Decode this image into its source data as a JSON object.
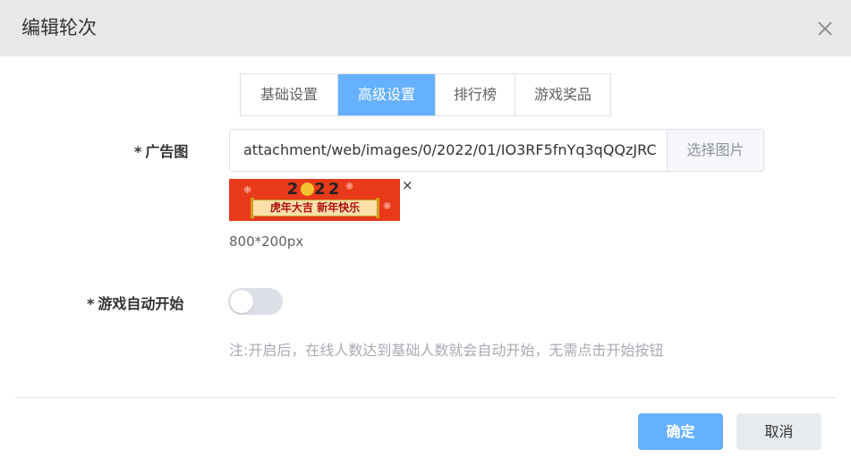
{
  "dialog": {
    "title": "编辑轮次"
  },
  "tabs": [
    {
      "label": "基础设置",
      "active": false
    },
    {
      "label": "高级设置",
      "active": true
    },
    {
      "label": "排行榜",
      "active": false
    },
    {
      "label": "游戏奖品",
      "active": false
    }
  ],
  "ad_image": {
    "required_mark": "*",
    "label": "广告图",
    "path_value": "attachment/web/images/0/2022/01/IO3RF5fnYq3qQQzJRC",
    "choose_button": "选择图片",
    "remove_symbol": "×",
    "size_hint": "800*200px",
    "banner_year_left": "2",
    "banner_year_right": "22",
    "banner_text": "虎年大吉  新年快乐"
  },
  "auto_start": {
    "required_mark": "*",
    "label": "游戏自动开始",
    "enabled": false,
    "note": "注:开启后，在线人数达到基础人数就会自动开始，无需点击开始按钮"
  },
  "footer": {
    "confirm_label": "确定",
    "cancel_label": "取消"
  },
  "colors": {
    "primary": "#66b1ff",
    "header_bg": "#e8e8e8",
    "switch_off": "#dcdfe6"
  }
}
